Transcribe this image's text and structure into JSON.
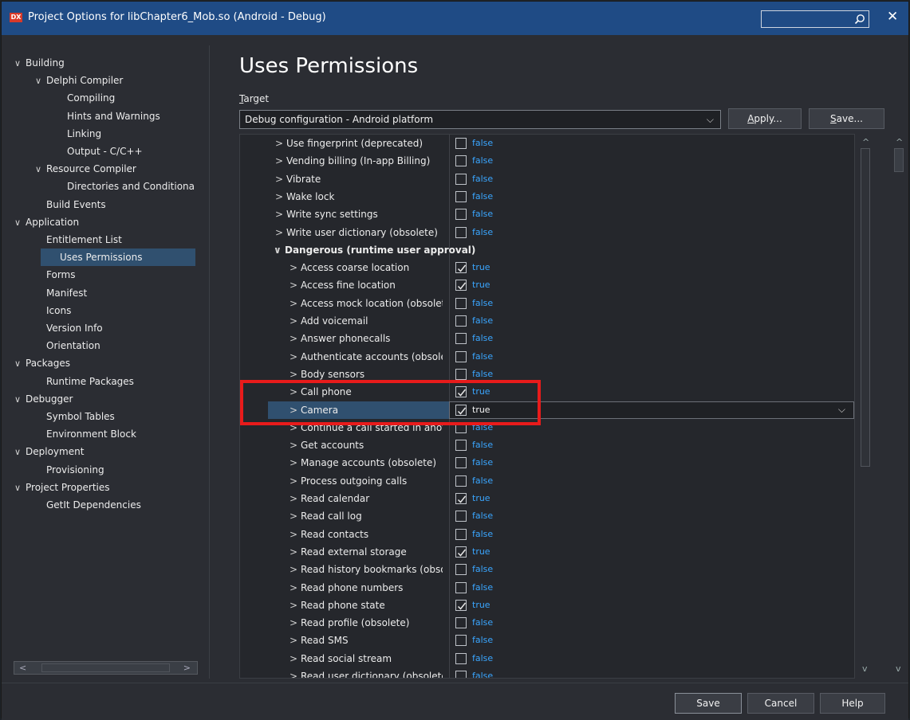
{
  "window": {
    "title": "Project Options for libChapter6_Mob.so  (Android - Debug)",
    "app_icon": "DX"
  },
  "sidebar": {
    "items": [
      {
        "label": "Building",
        "level": 0,
        "expanded": true
      },
      {
        "label": "Delphi Compiler",
        "level": 1,
        "expanded": true
      },
      {
        "label": "Compiling",
        "level": 2
      },
      {
        "label": "Hints and Warnings",
        "level": 2
      },
      {
        "label": "Linking",
        "level": 2
      },
      {
        "label": "Output - C/C++",
        "level": 2
      },
      {
        "label": "Resource Compiler",
        "level": 1,
        "expanded": true
      },
      {
        "label": "Directories and Conditiona",
        "level": 2
      },
      {
        "label": "Build Events",
        "level": 1
      },
      {
        "label": "Application",
        "level": 0,
        "expanded": true
      },
      {
        "label": "Entitlement List",
        "level": 1
      },
      {
        "label": "Uses Permissions",
        "level": 1,
        "selected": true
      },
      {
        "label": "Forms",
        "level": 1
      },
      {
        "label": "Manifest",
        "level": 1
      },
      {
        "label": "Icons",
        "level": 1
      },
      {
        "label": "Version Info",
        "level": 1
      },
      {
        "label": "Orientation",
        "level": 1
      },
      {
        "label": "Packages",
        "level": 0,
        "expanded": true
      },
      {
        "label": "Runtime Packages",
        "level": 1
      },
      {
        "label": "Debugger",
        "level": 0,
        "expanded": true
      },
      {
        "label": "Symbol Tables",
        "level": 1
      },
      {
        "label": "Environment Block",
        "level": 1
      },
      {
        "label": "Deployment",
        "level": 0,
        "expanded": true
      },
      {
        "label": "Provisioning",
        "level": 1
      },
      {
        "label": "Project Properties",
        "level": 0,
        "expanded": true
      },
      {
        "label": "GetIt Dependencies",
        "level": 1
      }
    ]
  },
  "main": {
    "title": "Uses Permissions",
    "target_label": "Target",
    "target_value": "Debug configuration - Android platform",
    "apply_label": "Apply...",
    "save_target_label": "Save..."
  },
  "permissions": {
    "rows": [
      {
        "name": "Use fingerprint (deprecated)",
        "value": "false",
        "checked": false
      },
      {
        "name": "Vending billing (In-app Billing)",
        "value": "false",
        "checked": false
      },
      {
        "name": "Vibrate",
        "value": "false",
        "checked": false
      },
      {
        "name": "Wake lock",
        "value": "false",
        "checked": false
      },
      {
        "name": "Write sync settings",
        "value": "false",
        "checked": false
      },
      {
        "name": "Write user dictionary (obsolete)",
        "value": "false",
        "checked": false
      },
      {
        "name": "Dangerous (runtime user approval)",
        "category": true
      },
      {
        "name": "Access coarse location",
        "value": "true",
        "checked": true
      },
      {
        "name": "Access fine location",
        "value": "true",
        "checked": true
      },
      {
        "name": "Access mock location (obsolet",
        "value": "false",
        "checked": false
      },
      {
        "name": "Add voicemail",
        "value": "false",
        "checked": false
      },
      {
        "name": "Answer phonecalls",
        "value": "false",
        "checked": false
      },
      {
        "name": "Authenticate accounts (obsole",
        "value": "false",
        "checked": false
      },
      {
        "name": "Body sensors",
        "value": "false",
        "checked": false
      },
      {
        "name": "Call phone",
        "value": "true",
        "checked": true
      },
      {
        "name": "Camera",
        "value": "true",
        "checked": true,
        "active": true
      },
      {
        "name": "Continue a call started in anot",
        "value": "false",
        "checked": false
      },
      {
        "name": "Get accounts",
        "value": "false",
        "checked": false
      },
      {
        "name": "Manage accounts (obsolete)",
        "value": "false",
        "checked": false
      },
      {
        "name": "Process outgoing calls",
        "value": "false",
        "checked": false
      },
      {
        "name": "Read calendar",
        "value": "true",
        "checked": true
      },
      {
        "name": "Read call log",
        "value": "false",
        "checked": false
      },
      {
        "name": "Read contacts",
        "value": "false",
        "checked": false
      },
      {
        "name": "Read external storage",
        "value": "true",
        "checked": true
      },
      {
        "name": "Read history bookmarks (obso",
        "value": "false",
        "checked": false
      },
      {
        "name": "Read phone numbers",
        "value": "false",
        "checked": false
      },
      {
        "name": "Read phone state",
        "value": "true",
        "checked": true
      },
      {
        "name": "Read profile (obsolete)",
        "value": "false",
        "checked": false
      },
      {
        "name": "Read SMS",
        "value": "false",
        "checked": false
      },
      {
        "name": "Read social stream",
        "value": "false",
        "checked": false
      },
      {
        "name": "Read user dictionary (obsolete)",
        "value": "false",
        "checked": false
      }
    ]
  },
  "footer": {
    "save_label": "Save",
    "cancel_label": "Cancel",
    "help_label": "Help"
  },
  "colors": {
    "titlebar": "#1f4b85",
    "selection": "#30506f",
    "value_text": "#3aa6ff",
    "highlight_box": "#e81b1b"
  }
}
